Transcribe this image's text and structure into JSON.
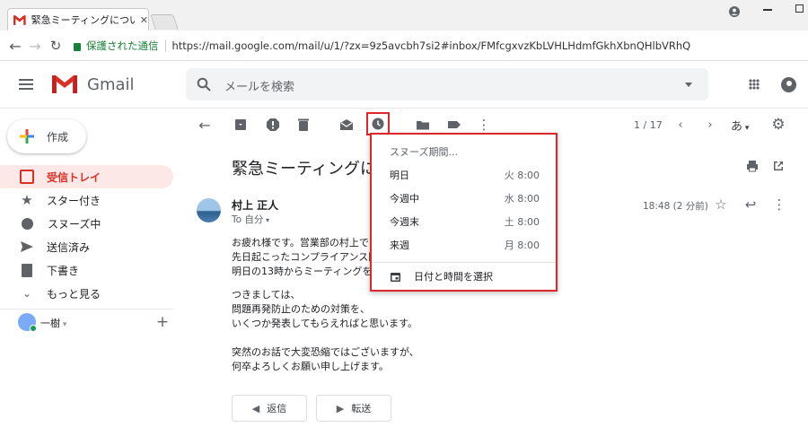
{
  "browser": {
    "tab_title": "緊急ミーティングについて - a",
    "secure_label": "保護された通信",
    "url": "https://mail.google.com/mail/u/1/?zx=9z5avcbh7si2#inbox/FMfcgxvzKbLVHLHdmfGkhXbnQHlbVRhQ"
  },
  "header": {
    "app_name": "Gmail",
    "search_placeholder": "メールを検索"
  },
  "sidebar": {
    "compose_label": "作成",
    "items": [
      {
        "label": "受信トレイ"
      },
      {
        "label": "スター付き"
      },
      {
        "label": "スヌーズ中"
      },
      {
        "label": "送信済み"
      },
      {
        "label": "下書き"
      },
      {
        "label": "もっと見る"
      }
    ],
    "account_name": "一樹"
  },
  "toolbar": {
    "pagination": "1 / 17",
    "input_tool": "あ"
  },
  "email": {
    "subject": "緊急ミーティングに",
    "sender": "村上 正人",
    "to_label": "To 自分",
    "time": "18:48 (2 分前)",
    "body": [
      "お疲れ様です。営業部の村上です",
      "先日起こったコンプライアンス問",
      "明日の13時からミーティングを行",
      "",
      "つきましては、",
      "問題再発防止のための対策を、",
      "いくつか発表してもらえればと思います。",
      "",
      "突然のお話で大変恐縮ではございますが、",
      "何卒よろしくお願い申し上げます。"
    ],
    "reply_label": "返信",
    "forward_label": "転送"
  },
  "snooze_menu": {
    "title": "スヌーズ期間...",
    "options": [
      {
        "label": "明日",
        "time": "火 8:00"
      },
      {
        "label": "今週中",
        "time": "水 8:00"
      },
      {
        "label": "今週末",
        "time": "土 8:00"
      },
      {
        "label": "来週",
        "time": "月 8:00"
      }
    ],
    "custom_label": "日付と時間を選択"
  },
  "colors": {
    "accent_red": "#d93025",
    "highlight_border": "#e0262b",
    "icon_gray": "#5f6368",
    "secure_green": "#188038"
  }
}
